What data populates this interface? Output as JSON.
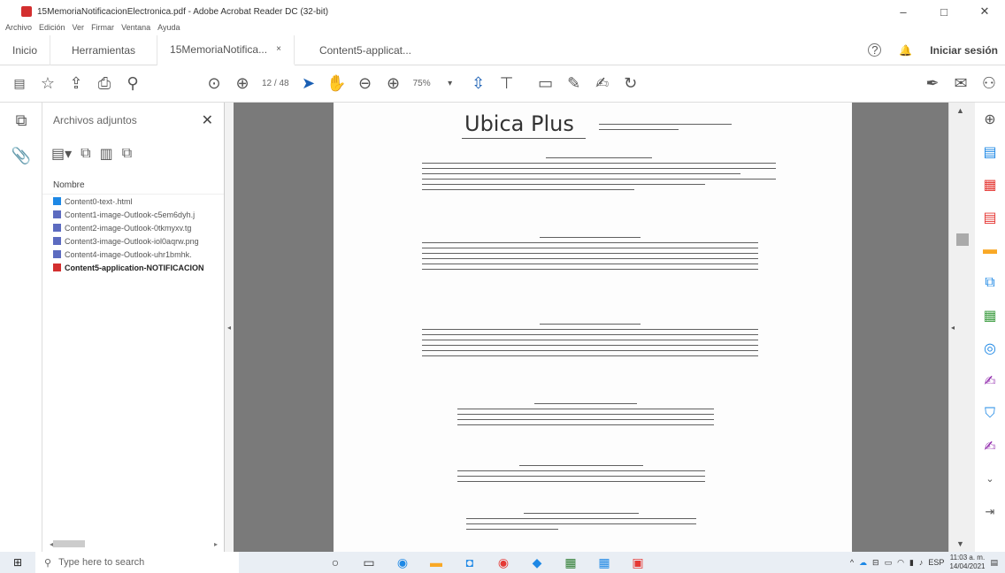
{
  "window": {
    "title": "15MemoriaNotificacionElectronica.pdf - Adobe Acrobat Reader DC (32-bit)",
    "controls": [
      "–",
      "□",
      "✕"
    ]
  },
  "menubar": [
    "Archivo",
    "Edición",
    "Ver",
    "Firmar",
    "Ventana",
    "Ayuda"
  ],
  "tabs": {
    "home": "Inicio",
    "tools": "Herramientas",
    "doc1": "15MemoriaNotifica...",
    "doc1_close": "×",
    "doc2": "Content5-applicat...",
    "help_icon": "?",
    "bell_icon": "🔔",
    "signin": "Iniciar sesión"
  },
  "toolbar": {
    "page_indicator": "12 / 48",
    "zoom": "75%"
  },
  "attachments": {
    "title": "Archivos adjuntos",
    "close": "✕",
    "column_header": "Nombre",
    "items": [
      {
        "label": "Content0-text-.html",
        "color": "#1e88e5"
      },
      {
        "label": "Content1-image-Outlook-c5em6dyh.j",
        "color": "#5c6bc0"
      },
      {
        "label": "Content2-image-Outlook-0tkmyxv.tg",
        "color": "#5c6bc0"
      },
      {
        "label": "Content3-image-Outlook-iol0aqrw.png",
        "color": "#5c6bc0"
      },
      {
        "label": "Content4-image-Outlook-uhr1bmhk.",
        "color": "#5c6bc0"
      },
      {
        "label": "Content5-application-NOTIFICACION",
        "color": "#d32f2f"
      }
    ]
  },
  "document": {
    "logo_text": "Ubica Plus"
  },
  "taskbar": {
    "search_placeholder": "Type here to search",
    "time": "11:03 a. m.",
    "date": "14/04/2021",
    "lang": "ESP"
  }
}
